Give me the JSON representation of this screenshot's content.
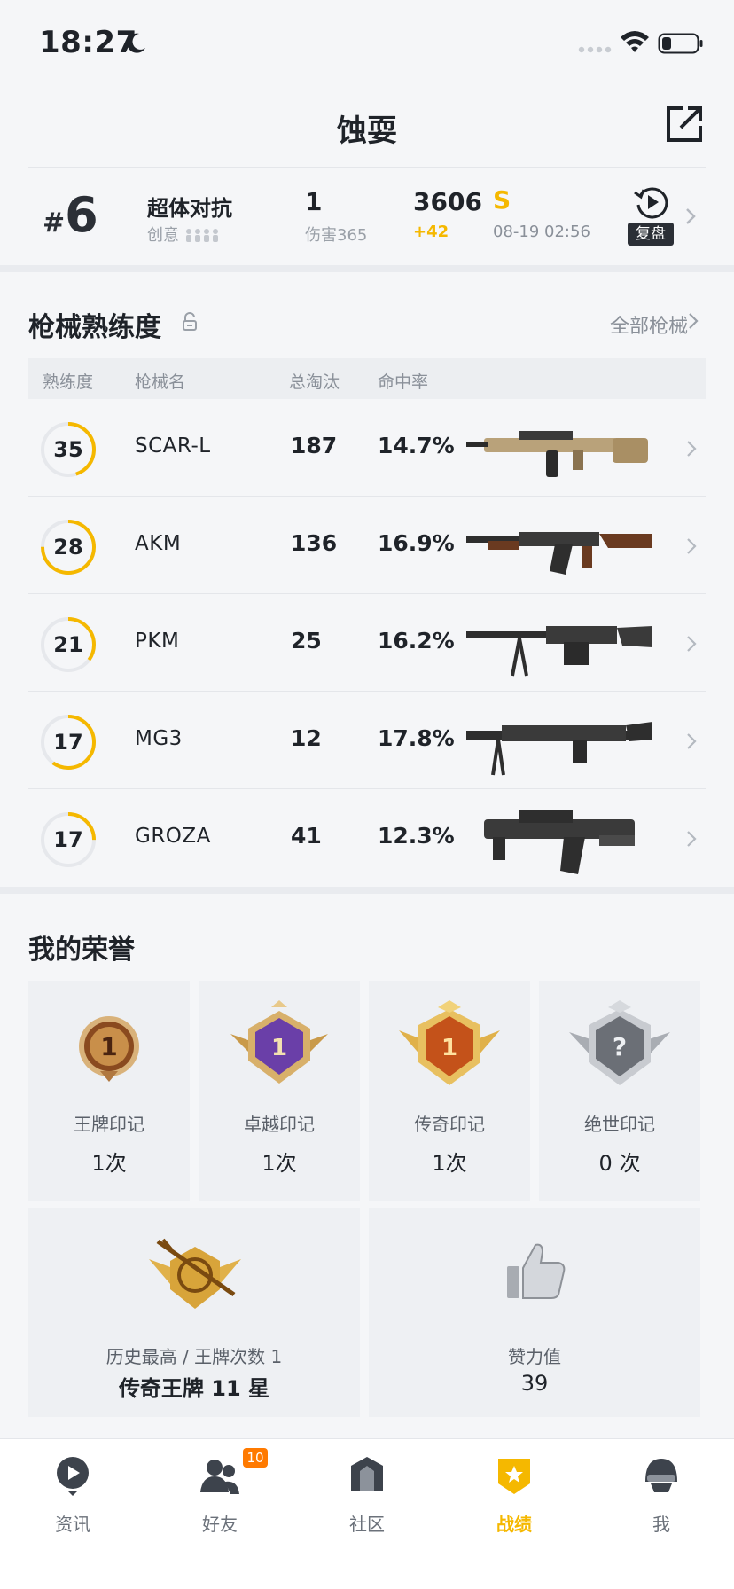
{
  "status_bar": {
    "time": "18:27"
  },
  "header": {
    "title": "蚀耍"
  },
  "last_match": {
    "rank_prefix": "#",
    "rank": "6",
    "mode": "超体对抗",
    "mode_sub": "创意",
    "kills": "1",
    "damage": "伤害365",
    "score": "3606",
    "score_delta": "+42",
    "tier": "S",
    "time": "08-19 02:56",
    "replay_label": "复盘"
  },
  "weapons": {
    "title": "枪械熟练度",
    "all_link": "全部枪械",
    "columns": {
      "proficiency": "熟练度",
      "name": "枪械名",
      "eliminations": "总淘汰",
      "accuracy": "命中率"
    },
    "rows": [
      {
        "level": "35",
        "progress": 0.45,
        "name": "SCAR-L",
        "eliminations": "187",
        "accuracy": "14.7%",
        "weapon_icon": "scar-l-rifle"
      },
      {
        "level": "28",
        "progress": 0.75,
        "name": "AKM",
        "eliminations": "136",
        "accuracy": "16.9%",
        "weapon_icon": "akm-rifle"
      },
      {
        "level": "21",
        "progress": 0.35,
        "name": "PKM",
        "eliminations": "25",
        "accuracy": "16.2%",
        "weapon_icon": "pkm-machine-gun"
      },
      {
        "level": "17",
        "progress": 0.6,
        "name": "MG3",
        "eliminations": "12",
        "accuracy": "17.8%",
        "weapon_icon": "mg3-machine-gun"
      },
      {
        "level": "17",
        "progress": 0.25,
        "name": "GROZA",
        "eliminations": "41",
        "accuracy": "12.3%",
        "weapon_icon": "groza-rifle"
      }
    ]
  },
  "honors": {
    "title": "我的荣誉",
    "marks": [
      {
        "label": "王牌印记",
        "count": "1次",
        "icon": "ace-mark-badge"
      },
      {
        "label": "卓越印记",
        "count": "1次",
        "icon": "excellence-mark-badge"
      },
      {
        "label": "传奇印记",
        "count": "1次",
        "icon": "legend-mark-badge"
      },
      {
        "label": "绝世印记",
        "count": "0 次",
        "icon": "peerless-mark-badge"
      }
    ],
    "history": {
      "label": "历史最高 / 王牌次数 1",
      "value": "传奇王牌 11 星",
      "icon": "sniper-rank-badge"
    },
    "likes": {
      "label": "赞力值",
      "value": "39",
      "icon": "thumbs-up-icon"
    }
  },
  "tabbar": {
    "items": [
      {
        "label": "资讯",
        "icon": "news-icon"
      },
      {
        "label": "好友",
        "icon": "friends-icon",
        "badge": "10"
      },
      {
        "label": "社区",
        "icon": "community-icon"
      },
      {
        "label": "战绩",
        "icon": "record-icon",
        "active": true
      },
      {
        "label": "我",
        "icon": "profile-helmet-icon"
      }
    ]
  },
  "colors": {
    "accent": "#f5b800",
    "badge": "#ff7a00",
    "background": "#f5f6f8"
  }
}
